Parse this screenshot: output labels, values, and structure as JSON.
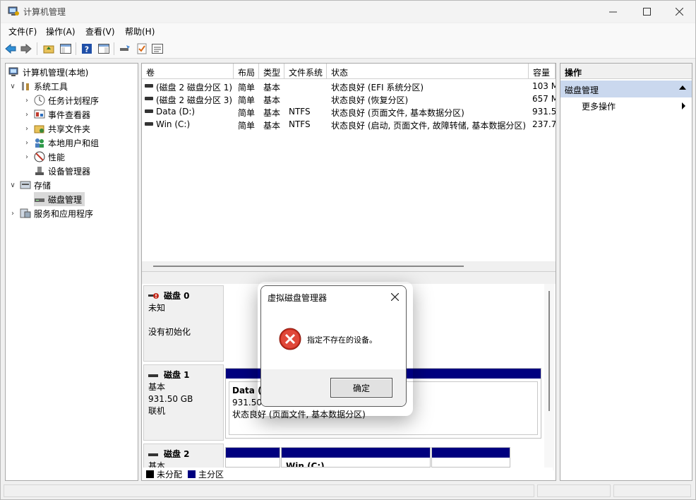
{
  "window": {
    "title": "计算机管理"
  },
  "menu": [
    "文件(F)",
    "操作(A)",
    "查看(V)",
    "帮助(H)"
  ],
  "tree": {
    "root": "计算机管理(本地)",
    "system_tools": "系统工具",
    "task_scheduler": "任务计划程序",
    "event_viewer": "事件查看器",
    "shared_folders": "共享文件夹",
    "local_users": "本地用户和组",
    "performance": "性能",
    "device_manager": "设备管理器",
    "storage": "存储",
    "disk_management": "磁盘管理",
    "services": "服务和应用程序"
  },
  "volume_list": {
    "headers": [
      "卷",
      "布局",
      "类型",
      "文件系统",
      "状态",
      "容量"
    ],
    "rows": [
      [
        "(磁盘 2 磁盘分区 1)",
        "简单",
        "基本",
        "",
        "状态良好 (EFI 系统分区)",
        "103 M"
      ],
      [
        "(磁盘 2 磁盘分区 3)",
        "简单",
        "基本",
        "",
        "状态良好 (恢复分区)",
        "657 M"
      ],
      [
        "Data (D:)",
        "简单",
        "基本",
        "NTFS",
        "状态良好 (页面文件, 基本数据分区)",
        "931.5("
      ],
      [
        "Win (C:)",
        "简单",
        "基本",
        "NTFS",
        "状态良好 (启动, 页面文件, 故障转储, 基本数据分区)",
        "237.7("
      ]
    ]
  },
  "disks": {
    "disk0": {
      "name": "磁盘 0",
      "type": "未知",
      "status": "没有初始化"
    },
    "disk1": {
      "name": "磁盘 1",
      "type": "基本",
      "size": "931.50 GB",
      "status": "联机",
      "partition": {
        "name": "Data (",
        "size": "931.50",
        "status": "状态良好 (页面文件, 基本数据分区)"
      }
    },
    "disk2": {
      "name": "磁盘 2",
      "type": "基本",
      "partition_label": "Win (C:)"
    }
  },
  "legend": {
    "unallocated": "未分配",
    "primary": "主分区"
  },
  "actions": {
    "header": "操作",
    "section": "磁盘管理",
    "more": "更多操作"
  },
  "dialog": {
    "title": "虚拟磁盘管理器",
    "message": "指定不存在的设备。",
    "ok": "确定"
  },
  "colors": {
    "primary_partition": "#00007f",
    "unallocated": "#000000",
    "action_section": "#cad8ee",
    "error_red": "#c42b1c"
  }
}
